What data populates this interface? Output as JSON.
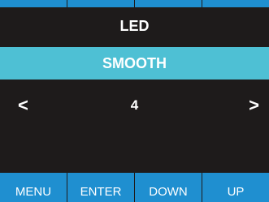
{
  "screen": {
    "title": "LED",
    "mode": "SMOOTH",
    "value": "4",
    "left_arrow": "<",
    "right_arrow": ">"
  },
  "buttons": [
    {
      "label": "MENU"
    },
    {
      "label": "ENTER"
    },
    {
      "label": "DOWN"
    },
    {
      "label": "UP"
    }
  ],
  "colors": {
    "background": "#1e1b1b",
    "button_blue": "#1f8fd0",
    "mode_bar": "#4ec0d4",
    "text": "#ffffff"
  }
}
